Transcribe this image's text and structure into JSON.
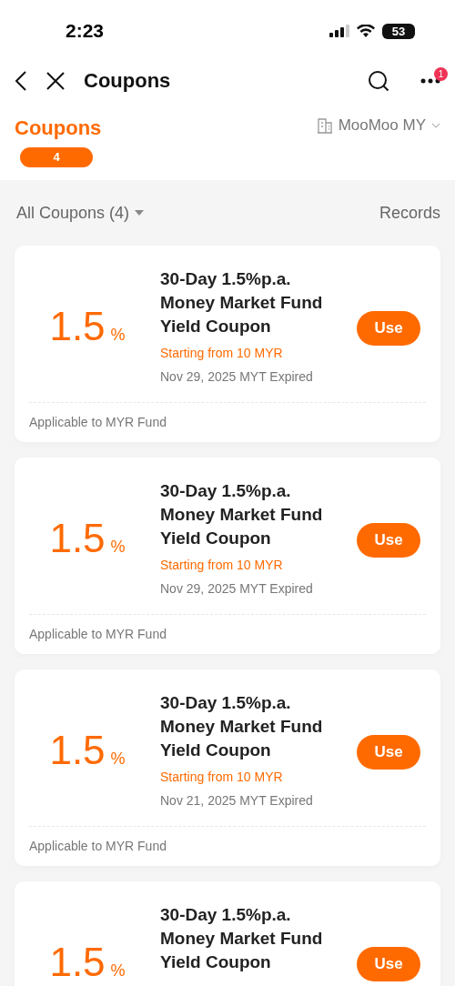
{
  "status_bar": {
    "time": "2:23",
    "battery": "53"
  },
  "nav": {
    "title": "Coupons",
    "more_badge": "1"
  },
  "header": {
    "title": "Coupons",
    "count": "4",
    "account": "MooMoo MY"
  },
  "filter": {
    "label": "All Coupons (4)",
    "records": "Records"
  },
  "coupons": [
    {
      "value": "1.5",
      "unit": "%",
      "title": "30-Day 1.5%p.a. Money Market Fund Yield Coupon",
      "minimum": "Starting from 10 MYR",
      "expiry": "Nov 29, 2025 MYT Expired",
      "action": "Use",
      "scope": "Applicable to MYR Fund"
    },
    {
      "value": "1.5",
      "unit": "%",
      "title": "30-Day 1.5%p.a. Money Market Fund Yield Coupon",
      "minimum": "Starting from 10 MYR",
      "expiry": "Nov 29, 2025 MYT Expired",
      "action": "Use",
      "scope": "Applicable to MYR Fund"
    },
    {
      "value": "1.5",
      "unit": "%",
      "title": "30-Day 1.5%p.a. Money Market Fund Yield Coupon",
      "minimum": "Starting from 10 MYR",
      "expiry": "Nov 21, 2025 MYT Expired",
      "action": "Use",
      "scope": "Applicable to MYR Fund"
    },
    {
      "value": "1.5",
      "unit": "%",
      "title": "30-Day 1.5%p.a. Money Market Fund Yield Coupon",
      "action": "Use"
    }
  ]
}
